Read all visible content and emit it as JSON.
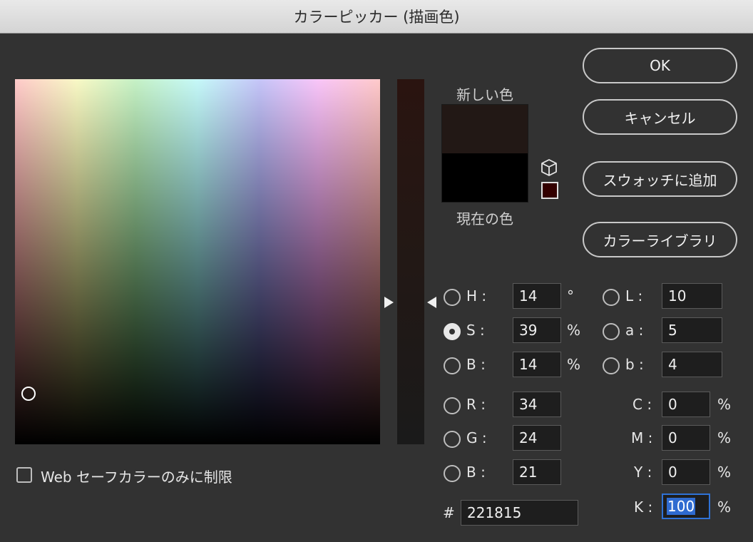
{
  "window": {
    "title": "カラーピッカー (描画色)"
  },
  "colors": {
    "new": "#221815",
    "current": "#000000",
    "websafe": "#330000",
    "focus": "#2f72d6"
  },
  "preview": {
    "new_label": "新しい色",
    "current_label": "現在の色",
    "gamut_icon": "cube-icon"
  },
  "buttons": {
    "ok": "OK",
    "cancel": "キャンセル",
    "add_swatch": "スウォッチに追加",
    "library": "カラーライブラリ"
  },
  "hsb": {
    "h": {
      "label": "H :",
      "value": "14",
      "unit": "°"
    },
    "s": {
      "label": "S :",
      "value": "39",
      "unit": "%",
      "selected": true
    },
    "b": {
      "label": "B :",
      "value": "14",
      "unit": "%"
    }
  },
  "lab": {
    "l": {
      "label": "L :",
      "value": "10"
    },
    "a": {
      "label": "a :",
      "value": "5"
    },
    "b": {
      "label": "b :",
      "value": "4"
    }
  },
  "rgb": {
    "r": {
      "label": "R :",
      "value": "34"
    },
    "g": {
      "label": "G :",
      "value": "24"
    },
    "b": {
      "label": "B :",
      "value": "21"
    }
  },
  "cmyk": {
    "c": {
      "label": "C :",
      "value": "0",
      "unit": "%"
    },
    "m": {
      "label": "M :",
      "value": "0",
      "unit": "%"
    },
    "y": {
      "label": "Y :",
      "value": "0",
      "unit": "%"
    },
    "k": {
      "label": "K :",
      "value": "100",
      "unit": "%"
    }
  },
  "hex": {
    "label": "#",
    "value": "221815"
  },
  "web_only": {
    "label": "Web セーフカラーのみに制限",
    "checked": false
  }
}
